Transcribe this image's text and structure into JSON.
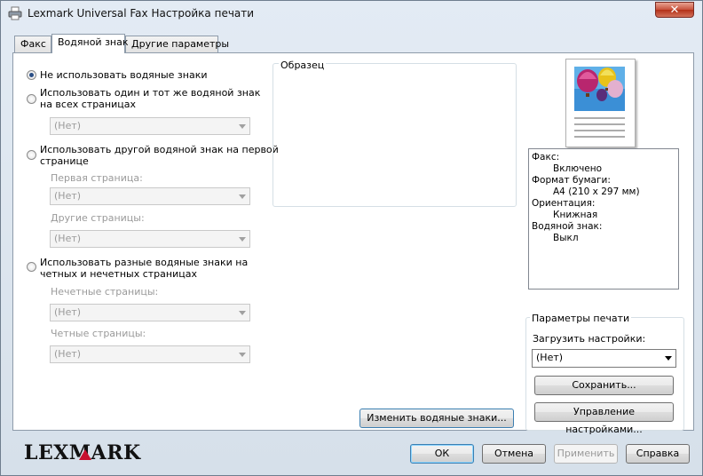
{
  "window": {
    "title": "Lexmark Universal Fax Настройка печати",
    "close_label": "✕"
  },
  "tabs": [
    {
      "label": "Факс"
    },
    {
      "label": "Водяной знак"
    },
    {
      "label": "Другие параметры"
    }
  ],
  "watermark": {
    "option_none": "Не использовать водяные знаки",
    "option_same_line1": "Использовать один и тот же водяной знак",
    "option_same_line2": "на всех страницах",
    "same_combo": "(Нет)",
    "option_first_line1": "Использовать другой водяной знак на первой",
    "option_first_line2": "странице",
    "first_page_label": "Первая страница:",
    "first_page_combo": "(Нет)",
    "other_pages_label": "Другие страницы:",
    "other_pages_combo": "(Нет)",
    "option_oddeven_line1": "Использовать разные водяные знаки на",
    "option_oddeven_line2": "четных и нечетных страницах",
    "odd_label": "Нечетные страницы:",
    "odd_combo": "(Нет)",
    "even_label": "Четные страницы:",
    "even_combo": "(Нет)",
    "sample_title": "Образец",
    "edit_button": "Изменить водяные знаки..."
  },
  "summary": [
    {
      "key": "Факс:",
      "value": "Включено"
    },
    {
      "key": "Формат бумаги:",
      "value": "A4 (210 x 297 мм)"
    },
    {
      "key": "Ориентация:",
      "value": "Книжная"
    },
    {
      "key": "Водяной знак:",
      "value": "Выкл"
    }
  ],
  "print_settings": {
    "title": "Параметры печати",
    "load_label": "Загрузить настройки:",
    "load_value": "(Нет)",
    "save_button": "Сохранить...",
    "manage_button": "Управление настройками..."
  },
  "footer": {
    "logo": "LEXMARK",
    "ok": "ОК",
    "cancel": "Отмена",
    "apply": "Применить",
    "help": "Справка"
  }
}
